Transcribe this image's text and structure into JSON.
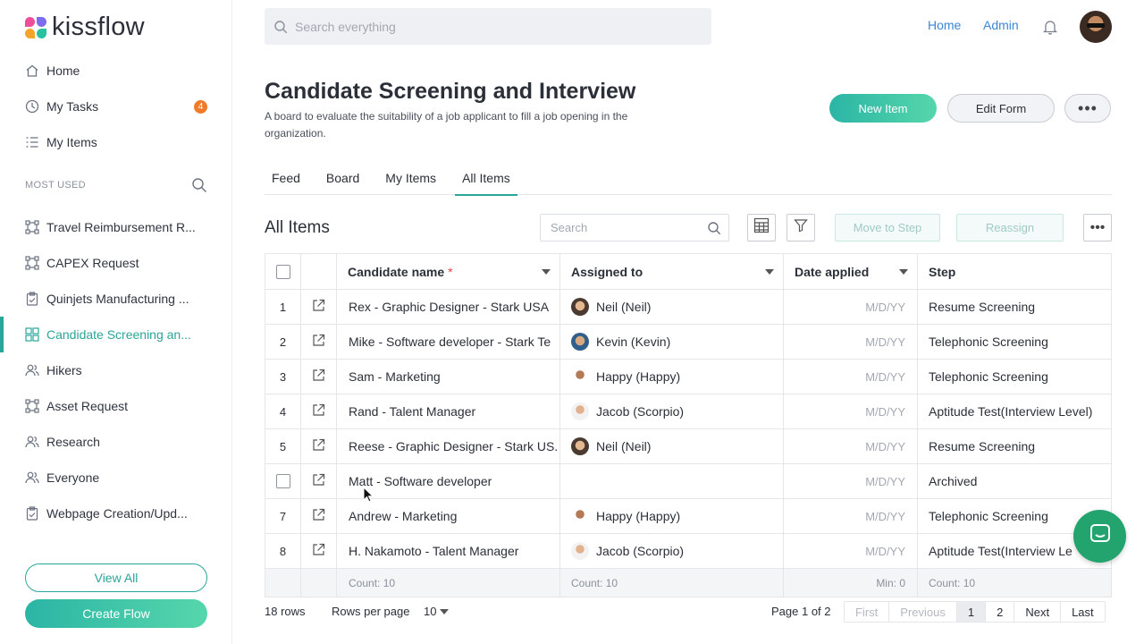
{
  "app": {
    "logo_text": "kissflow"
  },
  "sidebar": {
    "top_items": [
      {
        "label": "Home",
        "icon": "home-icon"
      },
      {
        "label": "My Tasks",
        "icon": "clock-icon",
        "badge": "4"
      },
      {
        "label": "My Items",
        "icon": "list-icon"
      }
    ],
    "section_label": "MOST USED",
    "items": [
      {
        "label": "Travel Reimbursement R...",
        "icon": "process-icon"
      },
      {
        "label": "CAPEX Request",
        "icon": "process-icon"
      },
      {
        "label": "Quinjets Manufacturing ...",
        "icon": "clipboard-icon"
      },
      {
        "label": "Candidate Screening an...",
        "icon": "board-icon",
        "active": true
      },
      {
        "label": "Hikers",
        "icon": "people-icon"
      },
      {
        "label": "Asset Request",
        "icon": "process-icon"
      },
      {
        "label": "Research",
        "icon": "people-icon"
      },
      {
        "label": "Everyone",
        "icon": "people-icon"
      },
      {
        "label": "Webpage Creation/Upd...",
        "icon": "clipboard-icon"
      }
    ],
    "view_all": "View All",
    "create_flow": "Create Flow"
  },
  "topbar": {
    "search_placeholder": "Search everything",
    "home_link": "Home",
    "admin_link": "Admin"
  },
  "page": {
    "title": "Candidate Screening and Interview",
    "description": "A board to evaluate the suitability of a job applicant to fill a job opening in the organization.",
    "new_item": "New Item",
    "edit_form": "Edit Form",
    "more": "•••"
  },
  "tabs": [
    "Feed",
    "Board",
    "My Items",
    "All Items"
  ],
  "active_tab": "All Items",
  "grid": {
    "title": "All Items",
    "search_placeholder": "Search",
    "move_to_step": "Move to Step",
    "reassign": "Reassign",
    "more": "•••",
    "columns": {
      "name": "Candidate name",
      "required_mark": "*",
      "assigned": "Assigned to",
      "date": "Date applied",
      "step": "Step"
    },
    "rows": [
      {
        "num": "1",
        "name": "Rex - Graphic Designer - Stark USA",
        "assignee": "Neil (Neil)",
        "avatar": "neil",
        "date": "M/D/YY",
        "step": "Resume Screening"
      },
      {
        "num": "2",
        "name": "Mike - Software developer - Stark Te",
        "assignee": "Kevin (Kevin)",
        "avatar": "kevin",
        "date": "M/D/YY",
        "step": "Telephonic Screening"
      },
      {
        "num": "3",
        "name": "Sam - Marketing",
        "assignee": "Happy (Happy)",
        "avatar": "happy",
        "date": "M/D/YY",
        "step": "Telephonic Screening"
      },
      {
        "num": "4",
        "name": "Rand - Talent Manager",
        "assignee": "Jacob (Scorpio)",
        "avatar": "jacob",
        "date": "M/D/YY",
        "step": "Aptitude Test(Interview Level)"
      },
      {
        "num": "5",
        "name": "Reese - Graphic Designer - Stark US.",
        "assignee": "Neil (Neil)",
        "avatar": "neil",
        "date": "M/D/YY",
        "step": "Resume Screening"
      },
      {
        "num": "",
        "name": "Matt - Software developer",
        "assignee": "",
        "avatar": "",
        "date": "M/D/YY",
        "step": "Archived",
        "checkbox": true
      },
      {
        "num": "7",
        "name": "Andrew - Marketing",
        "assignee": "Happy (Happy)",
        "avatar": "happy",
        "date": "M/D/YY",
        "step": "Telephonic Screening"
      },
      {
        "num": "8",
        "name": "H. Nakamoto - Talent Manager",
        "assignee": "Jacob (Scorpio)",
        "avatar": "jacob",
        "date": "M/D/YY",
        "step": "Aptitude Test(Interview Le"
      }
    ],
    "footer": {
      "name_count": "Count: 10",
      "assigned_count": "Count: 10",
      "date_min": "Min: 0",
      "step_count": "Count: 10"
    }
  },
  "pagination": {
    "rows_total": "18 rows",
    "rows_per_page_label": "Rows per page",
    "rows_per_page_value": "10",
    "page_of": "Page 1 of 2",
    "first": "First",
    "previous": "Previous",
    "pages": [
      "1",
      "2"
    ],
    "next": "Next",
    "last": "Last"
  },
  "colors": {
    "accent": "#2aa59a",
    "link": "#3a86d6",
    "badge": "#f07b2a",
    "chat": "#23a46f"
  }
}
